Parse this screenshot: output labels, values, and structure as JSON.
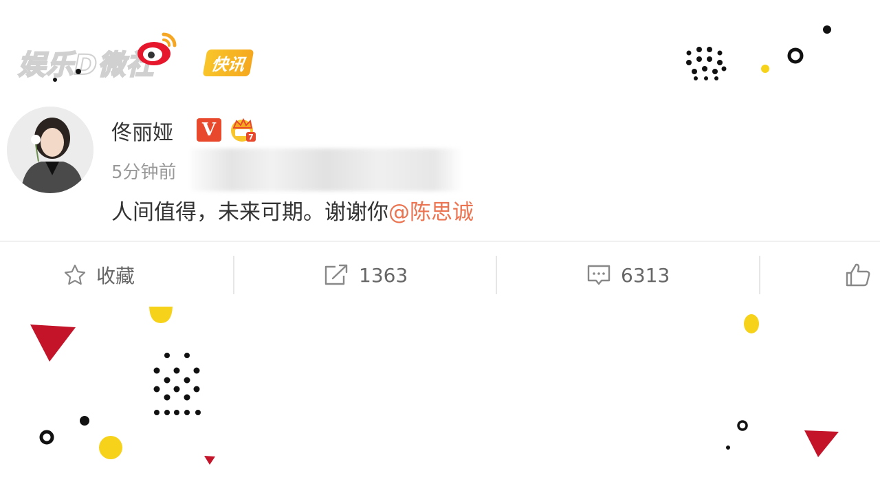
{
  "watermark": {
    "logo_text": "娱乐D微社",
    "badge": "快讯"
  },
  "post": {
    "username": "佟丽娅",
    "verified_badge": "V",
    "time": "5分钟前",
    "text_before_mention": "人间值得，未来可期。谢谢你",
    "mention": "@陈思诚"
  },
  "actions": {
    "favorite": {
      "label": "收藏",
      "icon": "star-icon"
    },
    "repost": {
      "label": "1363",
      "icon": "share-icon"
    },
    "comment": {
      "label": "6313",
      "icon": "comment-icon"
    },
    "like": {
      "label": "",
      "icon": "thumbs-up-icon"
    }
  },
  "colors": {
    "mention": "#eb7350",
    "verified": "#e8492c",
    "accent_yellow": "#f8c52a",
    "accent_red": "#c3142a"
  }
}
